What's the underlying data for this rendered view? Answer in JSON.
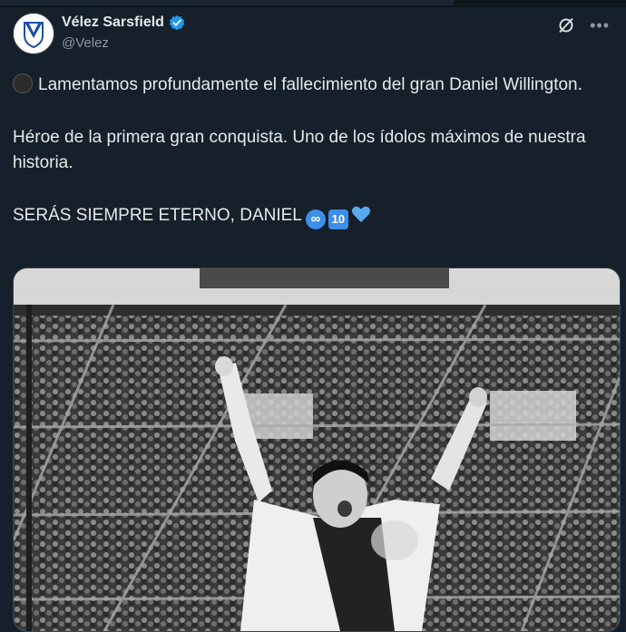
{
  "tweet": {
    "author": {
      "display_name": "Vélez Sarsfield",
      "handle": "@Velez",
      "verified": true
    },
    "paragraphs": {
      "p1": "Lamentamos profundamente el fallecimiento del gran Daniel Willington.",
      "p2": "Héroe de la primera gran conquista. Uno de los ídolos máximos de nuestra historia.",
      "p3": "SERÁS SIEMPRE ETERNO, DANIEL"
    },
    "emojis": {
      "mourning": "black-circle-icon",
      "infinity": "∞",
      "keycap_ten": "10",
      "heart": "blue-heart-icon"
    },
    "media": {
      "type": "photo",
      "style": "black-and-white"
    },
    "colors": {
      "background": "#15202b",
      "verified_blue": "#1d9bf0",
      "emoji_blue": "#3d8ee8",
      "secondary_text": "#8b98a5"
    }
  }
}
